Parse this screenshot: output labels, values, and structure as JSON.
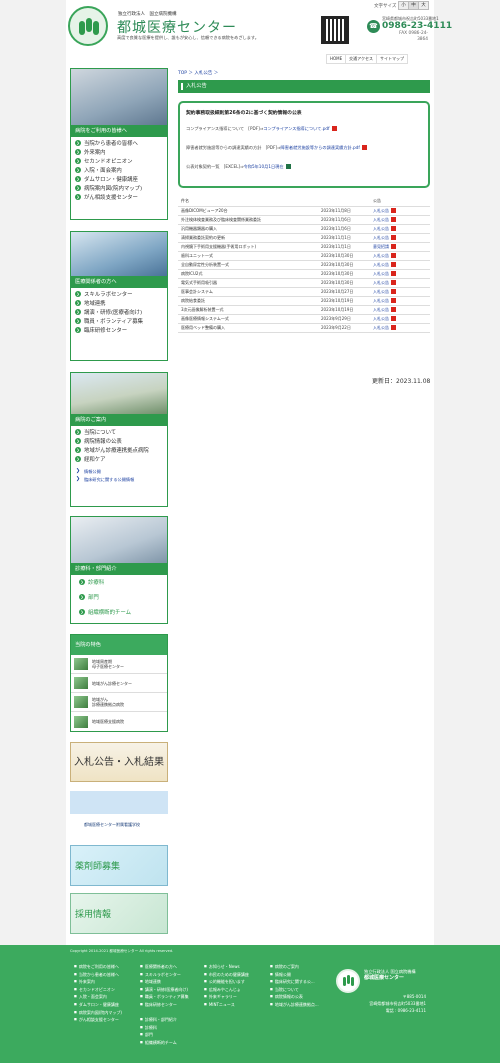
{
  "header": {
    "sub": "独立行政法人　国立病院機構",
    "title": "都城医療センター",
    "tagline": "高度で良質な医療を提供し、誰もが安心し、信頼できる病院をめざします。",
    "font_size_label": "文字サイズ",
    "size_buttons": [
      "小",
      "中",
      "大"
    ],
    "address": "宮崎県都城市祝吉町5033番地1",
    "tel": "0986-23-4111",
    "fax": "FAX 0986-24-3864",
    "util_links": [
      "HOME",
      "交通アクセス",
      "サイトマップ"
    ]
  },
  "sidebar": {
    "patient": {
      "title": "病院をご利用の皆様へ",
      "items": [
        "当院から患者の皆様へ",
        "外来案内",
        "セカンドオピニオン",
        "入院・面会案内",
        "ダムサロン・健康講座",
        "病院案内図(院内マップ)",
        "がん相談支援センター"
      ]
    },
    "medical": {
      "title": "医療関係者の方へ",
      "items": [
        "スキルラボセンター",
        "地域連携",
        "講演・研修(医療者向け)",
        "職員・ボランティア募集",
        "臨床研修センター"
      ]
    },
    "about": {
      "title": "病院のご案内",
      "items": [
        "当院について",
        "病院情報の公表",
        "地域がん診療連携拠点病院",
        "経和ケア"
      ],
      "sub_items": [
        "情報公開",
        "臨床研究に関する公開情報"
      ]
    },
    "dept": {
      "title": "診療科・部門紹介",
      "items": [
        "診療科",
        "部門",
        "組織横断的チーム"
      ]
    },
    "features": {
      "title": "当院の特色",
      "items": [
        "地域周産期\n母子医療センター",
        "地域がん診療センター",
        "地域がん\n診療連携拠点病院",
        "地域医療支援病院"
      ]
    },
    "banners": {
      "bid": "入札公告・入札結果",
      "school": "都城医療センター附属看護学校",
      "pharm": "薬剤師募集",
      "recruit": "採用情報"
    }
  },
  "main": {
    "breadcrumb": "TOP ＞ 入札公告 ＞",
    "section_title": "入札公告",
    "notice": {
      "title": "契約事務取扱細則第26条の2に基づく契約情報の公表",
      "lines": [
        {
          "label": "コンプライアンス指導について　[PDF]⇒",
          "link": "コンプライアンス指導について.pdf"
        },
        {
          "label": "障害者就労施設等からの調達実績の方針　[PDF]⇒",
          "link": "障害者就労施設等からの調達実績方針.pdf"
        },
        {
          "label": "公表対象契約一覧　[EXCEL]⇒",
          "link": "令和5年10月1日現在"
        }
      ]
    },
    "table": {
      "headers": [
        "件名",
        "",
        "公告"
      ],
      "rows": [
        [
          "画像DICOMビューア20台",
          "2023年11月8日",
          "入札公告"
        ],
        [
          "外注検体検査業務及び臨床検査関係業務委託",
          "2023年11月6日",
          "入札公告"
        ],
        [
          "汎用機器類器の購入",
          "2023年11月6日",
          "入札公告"
        ],
        [
          "清掃業務委託契約の更新",
          "2023年11月1日",
          "入札公告"
        ],
        [
          "内視鏡下手術用支援機器(手術用ロボット)",
          "2023年11月1日",
          "意見招請"
        ],
        [
          "歯科ユニット一式",
          "2023年10月30日",
          "入札公告"
        ],
        [
          "全自動尿定性分析装置一式",
          "2023年10月30日",
          "入札公告"
        ],
        [
          "病院ICU2式",
          "2023年10月30日",
          "入札公告"
        ],
        [
          "電気式手術用吸引器",
          "2023年10月30日",
          "入札公告"
        ],
        [
          "医事会計システム",
          "2023年10月27日",
          "入札公告"
        ],
        [
          "病院給食委託",
          "2023年10月19日",
          "入札公告"
        ],
        [
          "3次元画像解析装置一式",
          "2023年10月19日",
          "入札公告"
        ],
        [
          "画像医療情報システム一式",
          "2023年9月29日",
          "入札公告"
        ],
        [
          "医療用ベッド整備の購入",
          "2023年9月22日",
          "入札公告"
        ]
      ]
    },
    "updated": "更新日：2023.11.08"
  },
  "footer": {
    "copyright": "Copyright 2014-2021 都城医療センター All rights reserved.",
    "col1": [
      "病院をご利用の皆様へ",
      "当院から患者の皆様へ",
      "外来案内",
      "セカンドオピニオン",
      "入院・面会案内",
      "ダムサロン・健康講座",
      "病院案内図(院内マップ)",
      "がん相談支援センター"
    ],
    "col2": [
      "医療関係者の方へ",
      "スキルラボセンター",
      "地域連携",
      "講演・研修(医療者向け)",
      "職員・ボランティア募集",
      "臨床研修センター",
      "",
      "診療科・部門紹介",
      "診療科",
      "部門",
      "組織横断的チーム"
    ],
    "col3": [
      "お知らせ・News",
      "市民のための健康講座",
      "公的機能を担います",
      "広報みやこんじょ",
      "外来ギャラリー",
      "MINTニュース"
    ],
    "col4": [
      "病院のご案内",
      "情報公開",
      "臨床研究に関する公...",
      "当院について",
      "病院情報の公表",
      "地域がん診療連携拠点..."
    ],
    "org": "独立行政法人 国立病院機構",
    "name": "都城医療センター",
    "zip": "〒885-0014",
    "address": "宮崎県都城市祝吉町5033番地1",
    "tel": "電話 : 0986-23-4111"
  }
}
